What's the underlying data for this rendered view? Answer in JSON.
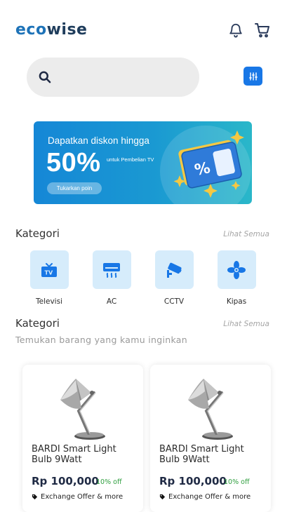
{
  "header": {
    "logo_eco": "eco",
    "logo_wise": "wise",
    "icons": [
      "bell-icon",
      "cart-icon"
    ]
  },
  "search": {
    "value": "",
    "placeholder": ""
  },
  "banner": {
    "title": "Dapatkan diskon hingga",
    "percent": "50%",
    "sub": "untuk Pembelian TV",
    "button": "Tukarkan poin"
  },
  "categories": {
    "title": "Kategori",
    "see_all": "Lihat Semua",
    "items": [
      {
        "label": "Televisi",
        "icon": "tv-icon"
      },
      {
        "label": "AC",
        "icon": "air-conditioner-icon"
      },
      {
        "label": "CCTV",
        "icon": "cctv-camera-icon"
      },
      {
        "label": "Kipas",
        "icon": "fan-icon"
      }
    ]
  },
  "products_section": {
    "title": "Kategori",
    "see_all": "Lihat Semua",
    "subtitle": "Temukan barang yang kamu inginkan",
    "items": [
      {
        "name": "BARDI Smart Light Bulb 9Watt",
        "price": "Rp 100,000",
        "discount": "10% off",
        "offer": "Exchange Offer & more"
      },
      {
        "name": "BARDI Smart Light Bulb 9Watt",
        "price": "Rp 100,000",
        "discount": "10% off",
        "offer": "Exchange Offer & more"
      }
    ]
  },
  "colors": {
    "accent": "#1877e6",
    "logo_eco": "#1e73b8",
    "logo_wise": "#1f3d5c",
    "category_tile": "#d6ecfb",
    "discount": "#2e9e3e"
  }
}
